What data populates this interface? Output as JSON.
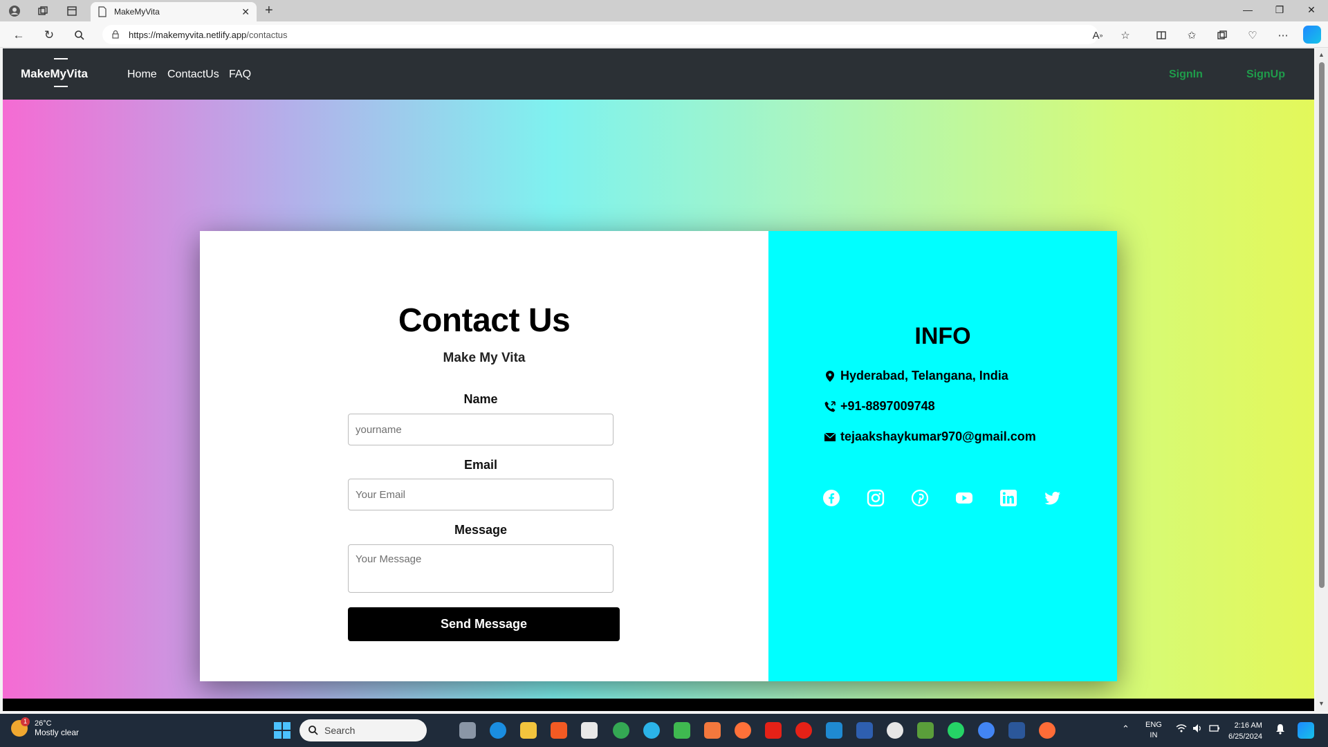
{
  "browser": {
    "tab_title": "MakeMyVita",
    "url_host": "https://makemyvita.netlify.app",
    "url_path": "/contactus"
  },
  "site_nav": {
    "brand": "MakeMyVita",
    "links": [
      "Home",
      "ContactUs",
      "FAQ"
    ],
    "signin": "SignIn",
    "signup": "SignUp"
  },
  "contact": {
    "title": "Contact Us",
    "subtitle": "Make My Vita",
    "name_label": "Name",
    "name_placeholder": "yourname",
    "email_label": "Email",
    "email_placeholder": "Your Email",
    "message_label": "Message",
    "message_placeholder": "Your Message",
    "submit": "Send Message"
  },
  "info": {
    "title": "INFO",
    "location": "Hyderabad, Telangana, India",
    "phone": "+91-8897009748",
    "email": "tejaakshaykumar970@gmail.com",
    "socials": [
      "facebook-icon",
      "instagram-icon",
      "pinterest-icon",
      "youtube-icon",
      "linkedin-icon",
      "twitter-icon"
    ]
  },
  "taskbar": {
    "temperature": "26°C",
    "weather": "Mostly clear",
    "weather_badge": "1",
    "search_placeholder": "Search",
    "language": "ENG",
    "region": "IN",
    "time": "2:16 AM",
    "date": "6/25/2024"
  },
  "colors": {
    "nav_bg": "#2b3035",
    "auth_green": "#1f9c4b",
    "info_bg": "#00ffff",
    "button_bg": "#000000"
  }
}
